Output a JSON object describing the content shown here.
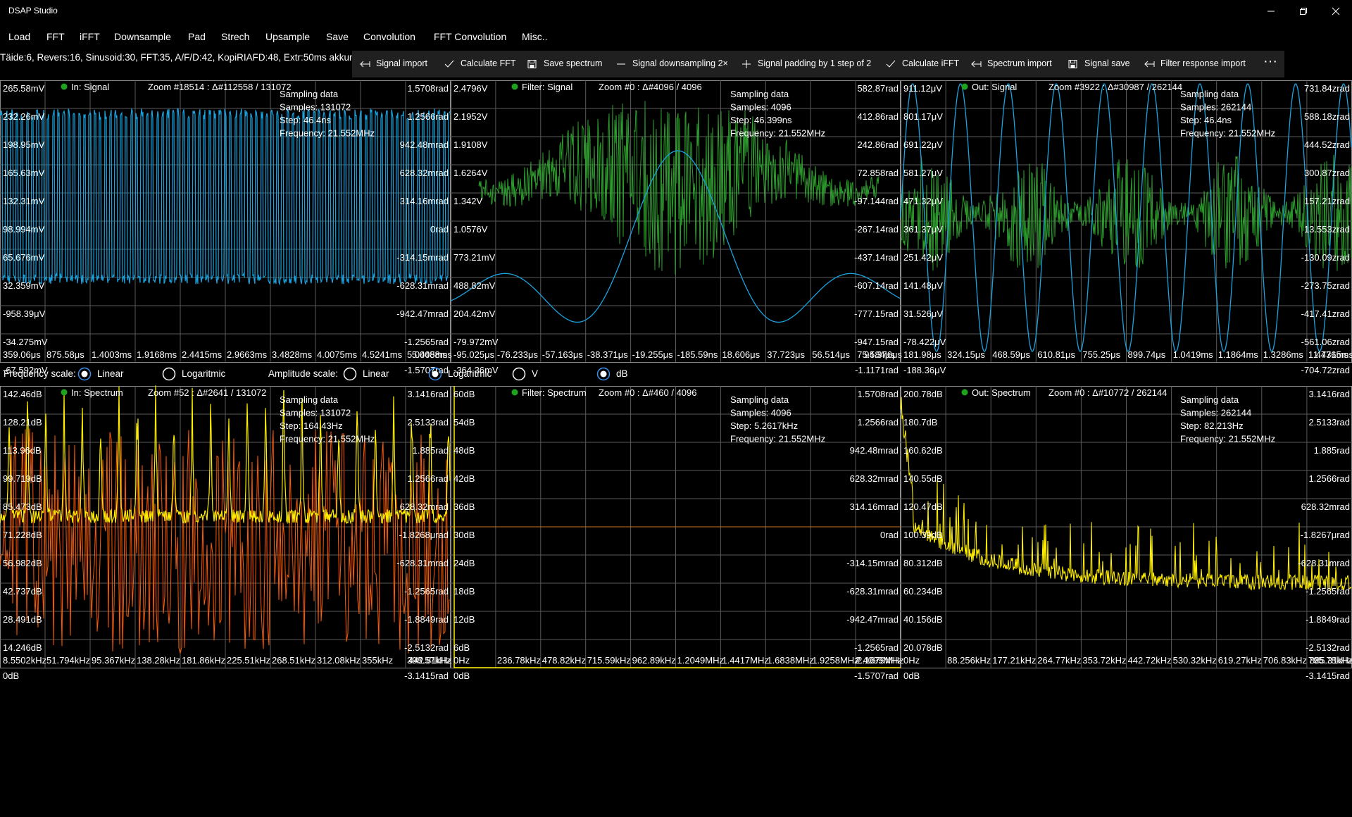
{
  "app": {
    "title": "DSAP Studio"
  },
  "menu": [
    "Load",
    "FFT",
    "iFFT",
    "Downsample",
    "Pad",
    "Strech",
    "Upsample",
    "Save",
    "Convolution",
    "FFT Convolution",
    "Misc.."
  ],
  "status_text": "Täide:6, Revers:16, Sinusoid:30, FFT:35, A/F/D:42, KopiRIAFD:48, Extr:50ms akkum.",
  "toolbar": [
    {
      "label": "Signal import",
      "icon": "arrow-left-icon"
    },
    {
      "label": "Calculate FFT",
      "icon": "check-icon"
    },
    {
      "label": "Save spectrum",
      "icon": "save-icon"
    },
    {
      "label": "Signal downsampling 2×",
      "icon": "minus-icon"
    },
    {
      "label": "Signal padding by 1 step of 2",
      "icon": "plus-icon"
    },
    {
      "label": "Calculate iFFT",
      "icon": "check-icon"
    },
    {
      "label": "Spectrum import",
      "icon": "arrow-left-icon"
    },
    {
      "label": "Signal save",
      "icon": "save-icon"
    },
    {
      "label": "Filter response import",
      "icon": "arrow-left-icon"
    }
  ],
  "more_label": "···",
  "options": {
    "frequency_scale_label": "Frequency scale:",
    "amplitude_scale_label": "Amplitude scale:",
    "radios": [
      {
        "label": "Linear",
        "checked": true
      },
      {
        "label": "Logaritmic",
        "checked": false
      },
      {
        "label": "Linear",
        "checked": false
      },
      {
        "label": "Logaritmic",
        "checked": true
      },
      {
        "label": "V",
        "checked": false
      },
      {
        "label": "dB",
        "checked": true
      }
    ]
  },
  "colors": {
    "signal": "#1aa3e0",
    "filter_noise": "#2d9d2d",
    "in_spectrum": "#ff5a00",
    "spectrum": "#ffee00",
    "grid": "#5a5a5a",
    "indicator": "#1fa31f"
  },
  "panels": [
    {
      "id": "in-signal",
      "title": "In: Signal",
      "zoom": "Zoom #18514 : Δ#112558 / 131072",
      "info": [
        "Sampling data",
        "Samples: 131072",
        "Step: 46.4ns",
        "Frequency: 21.552MHz"
      ],
      "left_ticks": [
        "265.58mV",
        "232.26mV",
        "198.95mV",
        "165.63mV",
        "132.31mV",
        "98.994mV",
        "65.676mV",
        "32.359mV",
        "-958.39μV",
        "-34.275mV",
        "-67.592mV"
      ],
      "right_ticks": [
        "1.5708rad",
        "1.2566rad",
        "942.48mrad",
        "628.32mrad",
        "314.16mrad",
        "0rad",
        "-314.15mrad",
        "-628.31mrad",
        "-942.47mrad",
        "-1.2565rad",
        "-1.5707rad"
      ],
      "bottom_ticks": [
        "359.06μs",
        "875.58μs",
        "1.4003ms",
        "1.9168ms",
        "2.4415ms",
        "2.9663ms",
        "3.4828ms",
        "4.0075ms",
        "4.5241ms",
        "5.0405ms",
        "5.0488ms"
      ]
    },
    {
      "id": "filter-signal",
      "title": "Filter: Signal",
      "zoom": "Zoom #0 : Δ#4096 / 4096",
      "info": [
        "Sampling data",
        "Samples: 4096",
        "Step: 46.399ns",
        "Frequency: 21.552MHz"
      ],
      "left_ticks": [
        "2.4796V",
        "2.1952V",
        "1.9108V",
        "1.6264V",
        "1.342V",
        "1.0576V",
        "773.21mV",
        "488.82mV",
        "204.42mV",
        "-79.972mV",
        "-364.36mV"
      ],
      "right_ticks": [
        "582.87rad",
        "412.86rad",
        "242.86rad",
        "72.858rad",
        "-97.144rad",
        "-267.14rad",
        "-437.14rad",
        "-607.14rad",
        "-777.15rad",
        "-947.15rad",
        "-1.1171rad"
      ],
      "bottom_ticks": [
        "-95.025μs",
        "-76.233μs",
        "-57.163μs",
        "-38.371μs",
        "-19.255μs",
        "-185.59ns",
        "18.606μs",
        "37.723μs",
        "56.514μs",
        "75.584μs",
        "94.376μs"
      ]
    },
    {
      "id": "out-signal",
      "title": "Out: Signal",
      "zoom": "Zoom #3922 : Δ#30987 / 262144",
      "info": [
        "Sampling data",
        "Samples: 262144",
        "Step: 46.4ns",
        "Frequency: 21.552MHz"
      ],
      "left_ticks": [
        "911.12μV",
        "801.17μV",
        "691.22μV",
        "581.27μV",
        "471.32μV",
        "361.37μV",
        "251.42μV",
        "141.48μV",
        "31.526μV",
        "-78.422μV",
        "-188.36μV"
      ],
      "right_ticks": [
        "731.84zrad",
        "588.18zrad",
        "444.52zrad",
        "300.87zrad",
        "157.21zrad",
        "13.553zrad",
        "-130.09zrad",
        "-273.75zrad",
        "-417.41zrad",
        "-561.06zrad",
        "-704.72zrad"
      ],
      "bottom_ticks": [
        "181.98μs",
        "324.15μs",
        "468.59μs",
        "610.81μs",
        "755.25μs",
        "899.74μs",
        "1.0419ms",
        "1.1864ms",
        "1.3286ms",
        "1.4731ms",
        "1.4765ms"
      ]
    },
    {
      "id": "in-spectrum",
      "title": "In: Spectrum",
      "zoom": "Zoom #52 : Δ#2641 / 131072",
      "info": [
        "Sampling data",
        "Samples: 131072",
        "Step: 164.43Hz",
        "Frequency: 21.552MHz"
      ],
      "left_ticks": [
        "142.46dB",
        "128.21dB",
        "113.96dB",
        "99.719dB",
        "85.473dB",
        "71.228dB",
        "56.982dB",
        "42.737dB",
        "28.491dB",
        "14.246dB",
        "0dB"
      ],
      "right_ticks": [
        "3.1416rad",
        "2.5133rad",
        "1.885rad",
        "1.2566rad",
        "628.32mrad",
        "-1.8268μrad",
        "-628.31mrad",
        "-1.2565rad",
        "-1.8849rad",
        "-2.5132rad",
        "-3.1415rad"
      ],
      "bottom_ticks": [
        "8.5502kHz",
        "51.794kHz",
        "95.367kHz",
        "138.28kHz",
        "181.86kHz",
        "225.51kHz",
        "268.51kHz",
        "312.08kHz",
        "355kHz",
        "398.57kHz",
        "442.81kHz"
      ]
    },
    {
      "id": "filter-spectrum",
      "title": "Filter: Spectrum",
      "zoom": "Zoom #0 : Δ#460 / 4096",
      "info": [
        "Sampling data",
        "Samples: 4096",
        "Step: 5.2617kHz",
        "Frequency: 21.552MHz"
      ],
      "left_ticks": [
        "60dB",
        "54dB",
        "48dB",
        "42dB",
        "36dB",
        "30dB",
        "24dB",
        "18dB",
        "12dB",
        "6dB",
        "0dB"
      ],
      "right_ticks": [
        "1.5708rad",
        "1.2566rad",
        "942.48mrad",
        "628.32mrad",
        "314.16mrad",
        "0rad",
        "-314.15mrad",
        "-628.31mrad",
        "-942.47mrad",
        "-1.2565rad",
        "-1.5707rad"
      ],
      "bottom_ticks": [
        "0Hz",
        "236.78kHz",
        "478.82kHz",
        "715.59kHz",
        "962.89kHz",
        "1.2049MHz",
        "1.4417MHz",
        "1.6838MHz",
        "1.9258MHz",
        "2.1679MHz",
        "2.4099MHz"
      ]
    },
    {
      "id": "out-spectrum",
      "title": "Out: Spectrum",
      "zoom": "Zoom #0 : Δ#10772 / 262144",
      "info": [
        "Sampling data",
        "Samples: 262144",
        "Step: 82.213Hz",
        "Frequency: 21.552MHz"
      ],
      "left_ticks": [
        "200.78dB",
        "180.7dB",
        "160.62dB",
        "140.55dB",
        "120.47dB",
        "100.39dB",
        "80.312dB",
        "60.234dB",
        "40.156dB",
        "20.078dB",
        "0dB"
      ],
      "right_ticks": [
        "3.1416rad",
        "2.5133rad",
        "1.885rad",
        "1.2566rad",
        "628.32mrad",
        "-1.8267μrad",
        "-628.31mrad",
        "-1.2565rad",
        "-1.8849rad",
        "-2.5132rad",
        "-3.1415rad"
      ],
      "bottom_ticks": [
        "0Hz",
        "88.256kHz",
        "177.21kHz",
        "264.77kHz",
        "353.72kHz",
        "442.72kHz",
        "530.32kHz",
        "619.27kHz",
        "706.83kHz",
        "795.78kHz",
        "885.31kHz"
      ]
    }
  ]
}
